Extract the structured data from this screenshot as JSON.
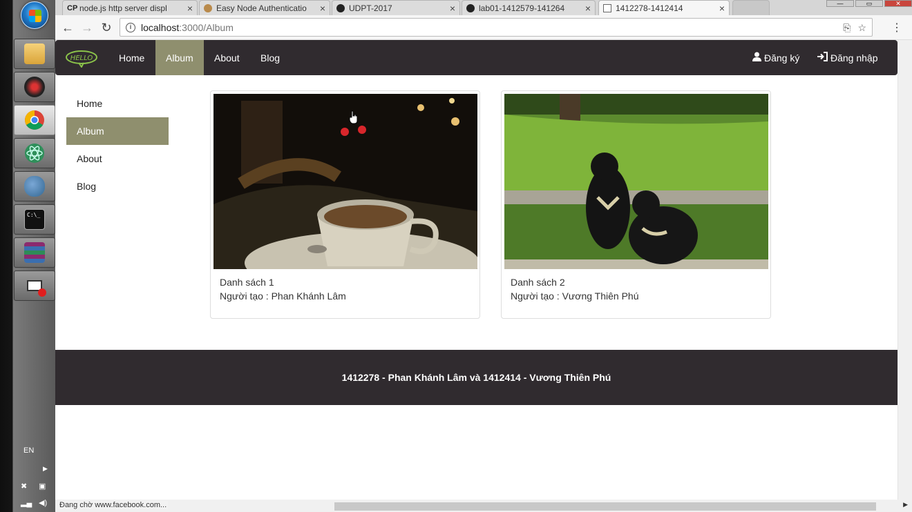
{
  "taskbar": {
    "apps": [
      {
        "icon": "file-explorer-icon",
        "color": "#e0b040"
      },
      {
        "icon": "app-icon",
        "color": "#2a2a2a"
      },
      {
        "icon": "chrome-icon",
        "color": "#4caf50"
      },
      {
        "icon": "atom-icon",
        "color": "#2f8f5a"
      },
      {
        "icon": "postgresql-icon",
        "color": "#336791"
      },
      {
        "icon": "terminal-icon",
        "color": "#111111"
      },
      {
        "icon": "winrar-icon",
        "color": "#8b2a6e"
      },
      {
        "icon": "recorder-icon",
        "color": "#d33333"
      }
    ],
    "lang": "EN"
  },
  "browser": {
    "tabs": [
      {
        "fav": "CP",
        "title": "node.js http server displ"
      },
      {
        "fav": "",
        "title": "Easy Node Authenticatio"
      },
      {
        "fav": "",
        "title": "UDPT-2017"
      },
      {
        "fav": "",
        "title": "lab01-1412579-141264"
      },
      {
        "fav": "",
        "title": "1412278-1412414"
      }
    ],
    "address": {
      "host": "localhost",
      "path": ":3000/Album"
    },
    "status": "Đang chờ www.facebook.com..."
  },
  "navbar": {
    "links": [
      "Home",
      "Album",
      "About",
      "Blog"
    ],
    "active": "Album",
    "register": "Đăng ký",
    "login": "Đăng nhập"
  },
  "sidebar": {
    "items": [
      "Home",
      "Album",
      "About",
      "Blog"
    ],
    "active": "Album"
  },
  "albums": [
    {
      "title": "Danh sách 1",
      "author": "Người tạo : Phan Khánh Lâm"
    },
    {
      "title": "Danh sách 2",
      "author": "Người tạo : Vương Thiên Phú"
    }
  ],
  "footer": {
    "text": "1412278 - Phan Khánh Lâm và 1412414 - Vương Thiên Phú"
  },
  "colors": {
    "navbar": "#302b2f",
    "accent": "#8f8f6e"
  }
}
